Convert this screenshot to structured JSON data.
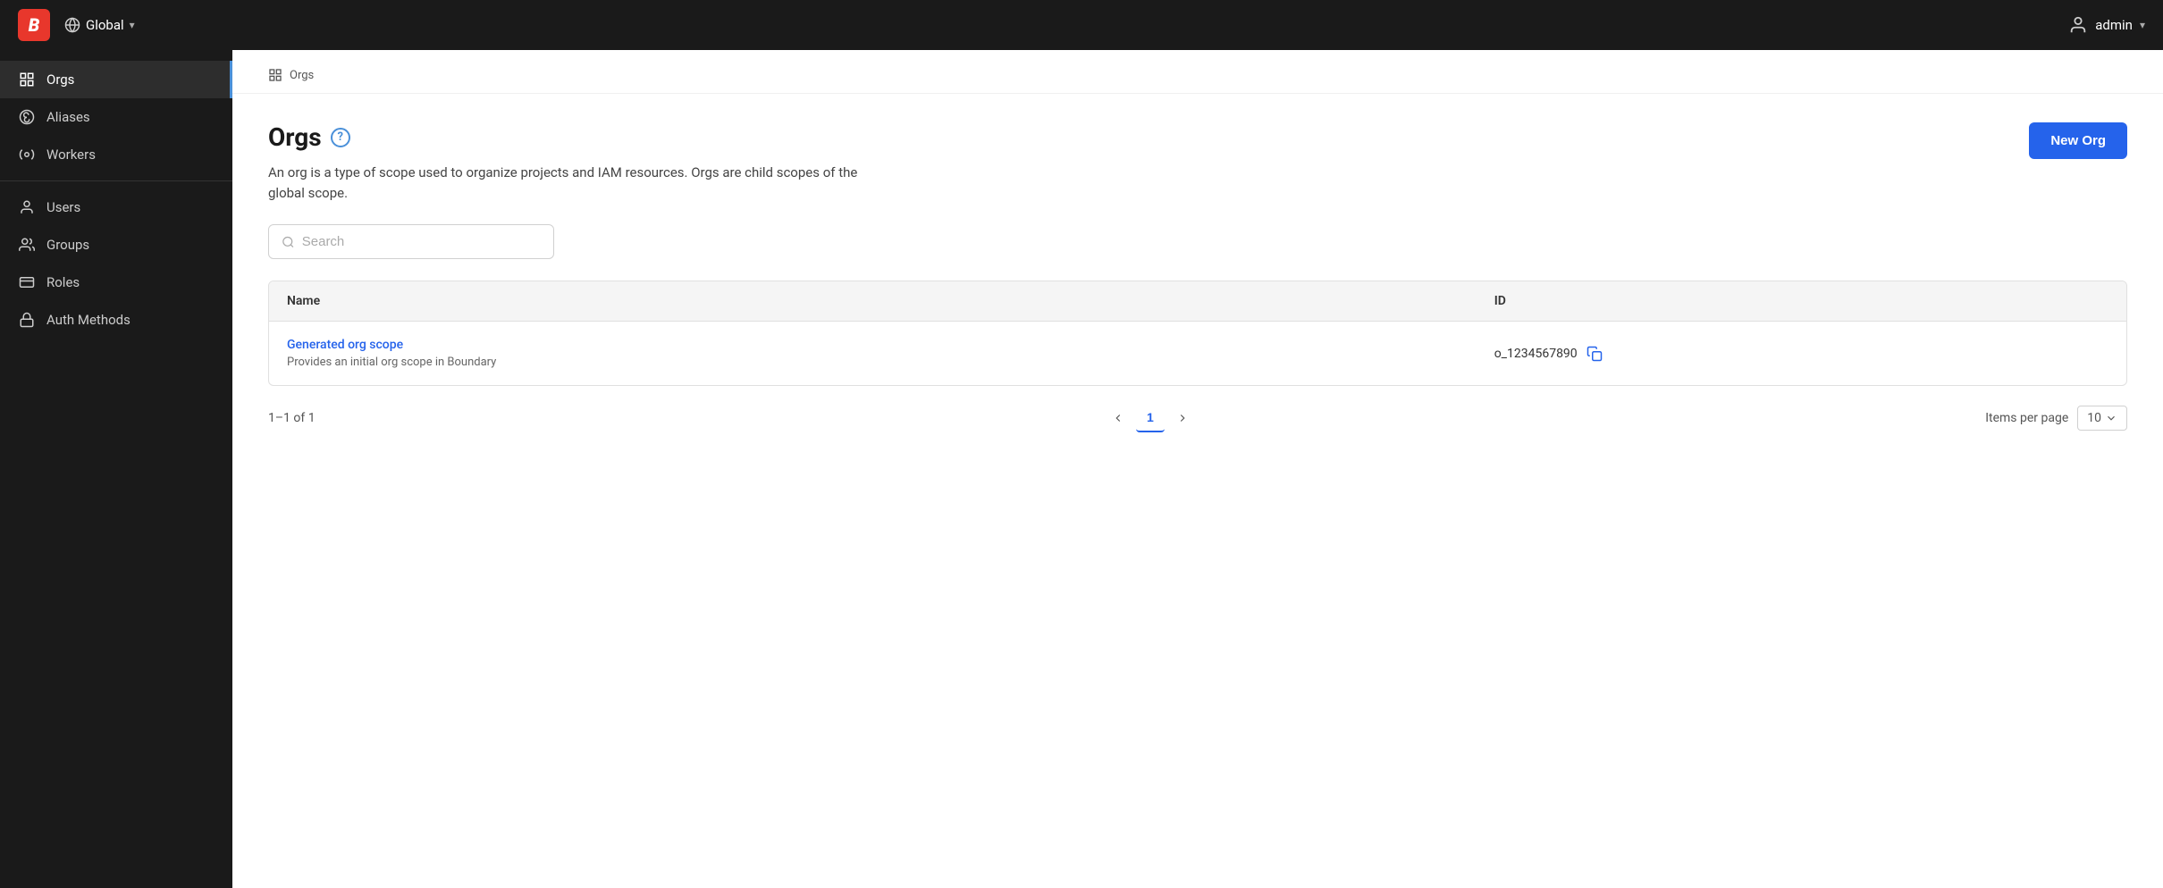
{
  "topNav": {
    "logo": "B",
    "global": {
      "label": "Global",
      "chevron": "▾"
    },
    "user": {
      "name": "admin",
      "chevron": "▾"
    }
  },
  "sidebar": {
    "items": [
      {
        "id": "orgs",
        "label": "Orgs",
        "icon": "grid",
        "active": true
      },
      {
        "id": "aliases",
        "label": "Aliases",
        "icon": "at"
      },
      {
        "id": "workers",
        "label": "Workers",
        "icon": "settings"
      }
    ],
    "divider": true,
    "items2": [
      {
        "id": "users",
        "label": "Users",
        "icon": "person"
      },
      {
        "id": "groups",
        "label": "Groups",
        "icon": "group"
      },
      {
        "id": "roles",
        "label": "Roles",
        "icon": "id"
      },
      {
        "id": "auth-methods",
        "label": "Auth Methods",
        "icon": "lock"
      }
    ]
  },
  "breadcrumb": {
    "icon": "grid",
    "label": "Orgs"
  },
  "page": {
    "title": "Orgs",
    "description": "An org is a type of scope used to organize projects and IAM resources. Orgs are child scopes of the global scope.",
    "newOrgButton": "New Org"
  },
  "search": {
    "placeholder": "Search"
  },
  "table": {
    "columns": [
      {
        "key": "name",
        "label": "Name"
      },
      {
        "key": "id",
        "label": "ID"
      }
    ],
    "rows": [
      {
        "name": "Generated org scope",
        "description": "Provides an initial org scope in Boundary",
        "id": "o_1234567890"
      }
    ]
  },
  "pagination": {
    "summary": "1–1 of 1",
    "currentPage": "1",
    "itemsPerPageLabel": "Items per page",
    "itemsPerPage": "10"
  }
}
